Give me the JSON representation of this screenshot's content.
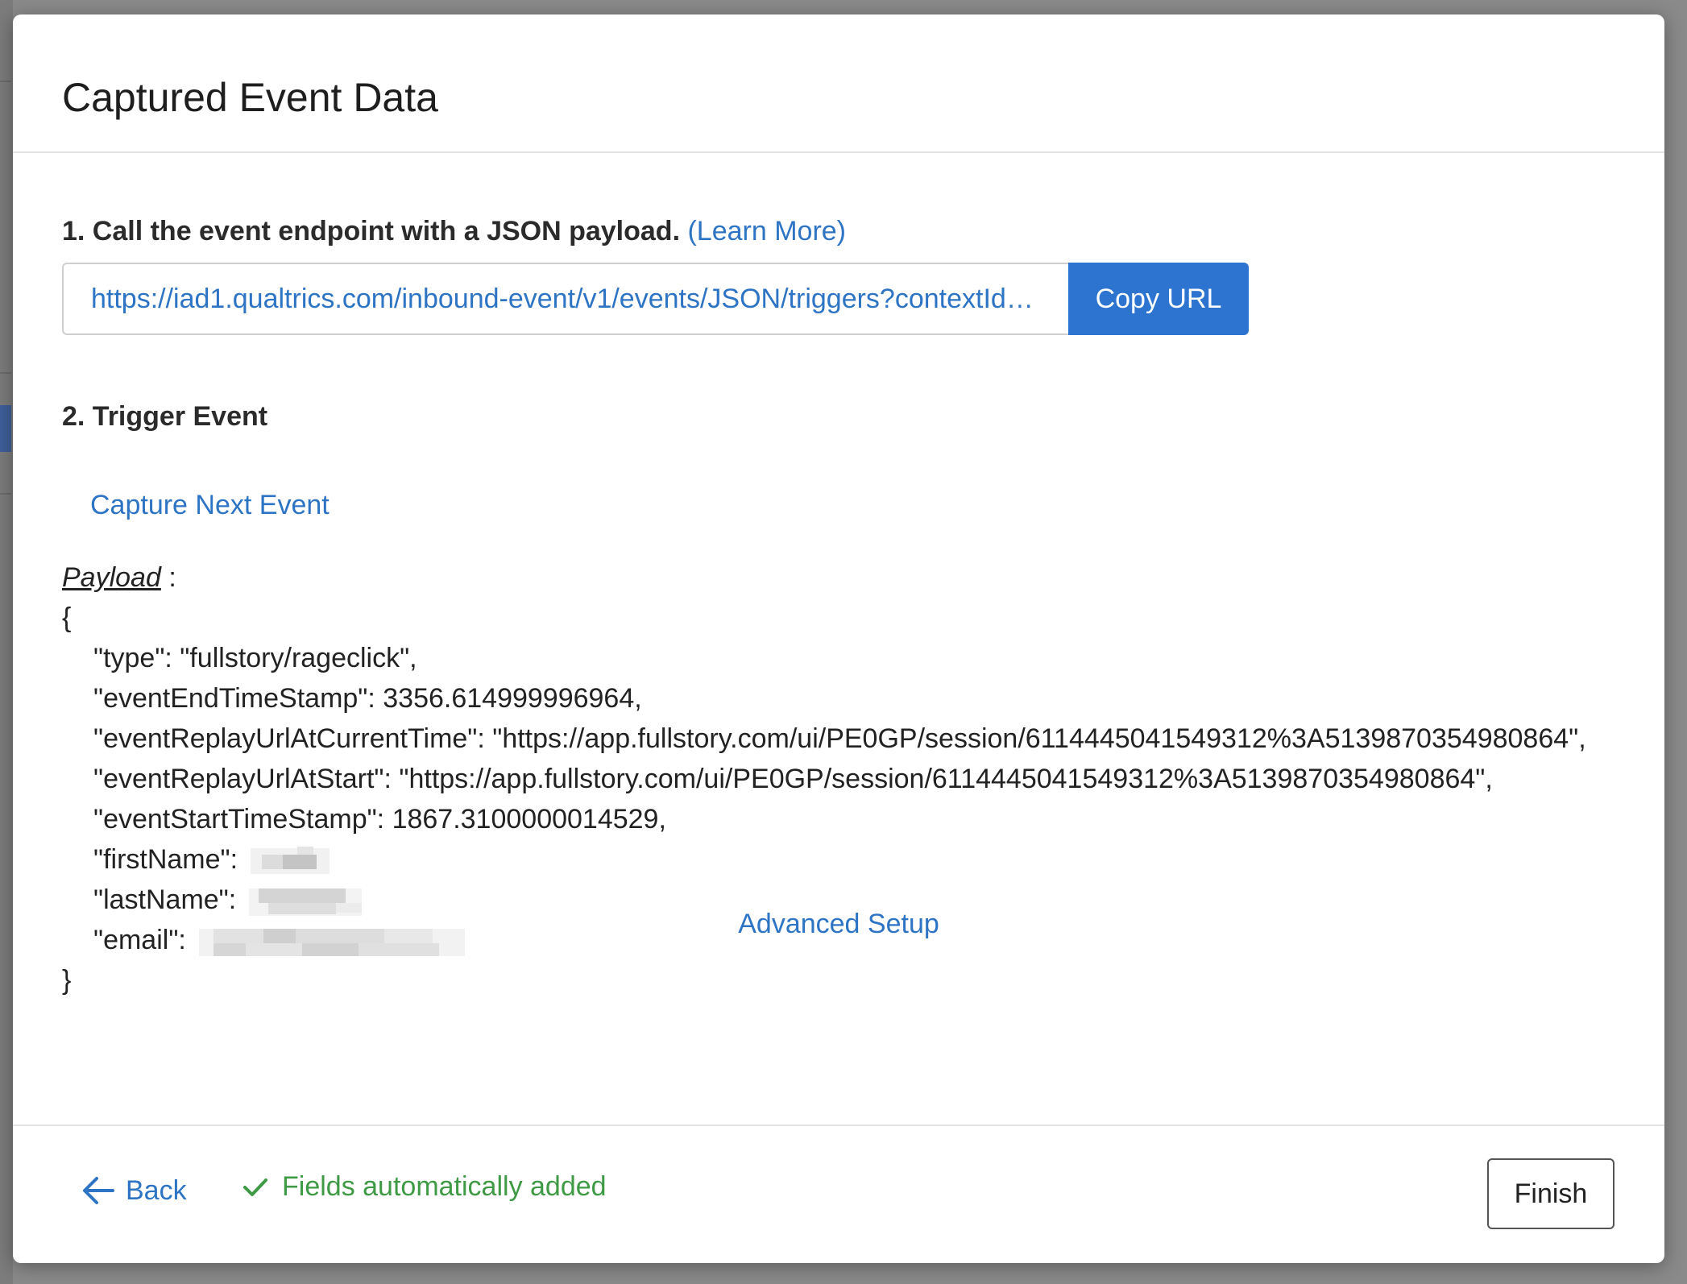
{
  "modal": {
    "title": "Captured Event Data"
  },
  "step1": {
    "label": "1. Call the event endpoint with a JSON payload.",
    "learn_more": "(Learn More)",
    "url": "https://iad1.qualtrics.com/inbound-event/v1/events/JSON/triggers?contextId=...",
    "copy_label": "Copy URL"
  },
  "step2": {
    "label": "2. Trigger Event",
    "capture_label": "Capture Next Event"
  },
  "payload": {
    "label": "Payload",
    "separator": " :",
    "open_brace": "{",
    "close_brace": "}",
    "lines": [
      "\"type\": \"fullstory/rageclick\",",
      "\"eventEndTimeStamp\": 3356.614999996964,",
      "\"eventReplayUrlAtCurrentTime\": \"https://app.fullstory.com/ui/PE0GP/session/6114445041549312%3A5139870354980864\",",
      "\"eventReplayUrlAtStart\": \"https://app.fullstory.com/ui/PE0GP/session/6114445041549312%3A5139870354980864\",",
      "\"eventStartTimeStamp\": 1867.3100000014529,"
    ],
    "redacted_fields": [
      {
        "key": "\"firstName\":"
      },
      {
        "key": "\"lastName\":"
      },
      {
        "key": "\"email\":"
      }
    ]
  },
  "advanced_setup": "Advanced Setup",
  "footer": {
    "back_label": "Back",
    "status_text": "Fields automatically added",
    "finish_label": "Finish"
  },
  "colors": {
    "link": "#2d74c4",
    "primary_button": "#2d74d1",
    "success": "#3f9a45"
  },
  "icons": {
    "back": "arrow-left-icon",
    "status": "checkmark-icon"
  }
}
